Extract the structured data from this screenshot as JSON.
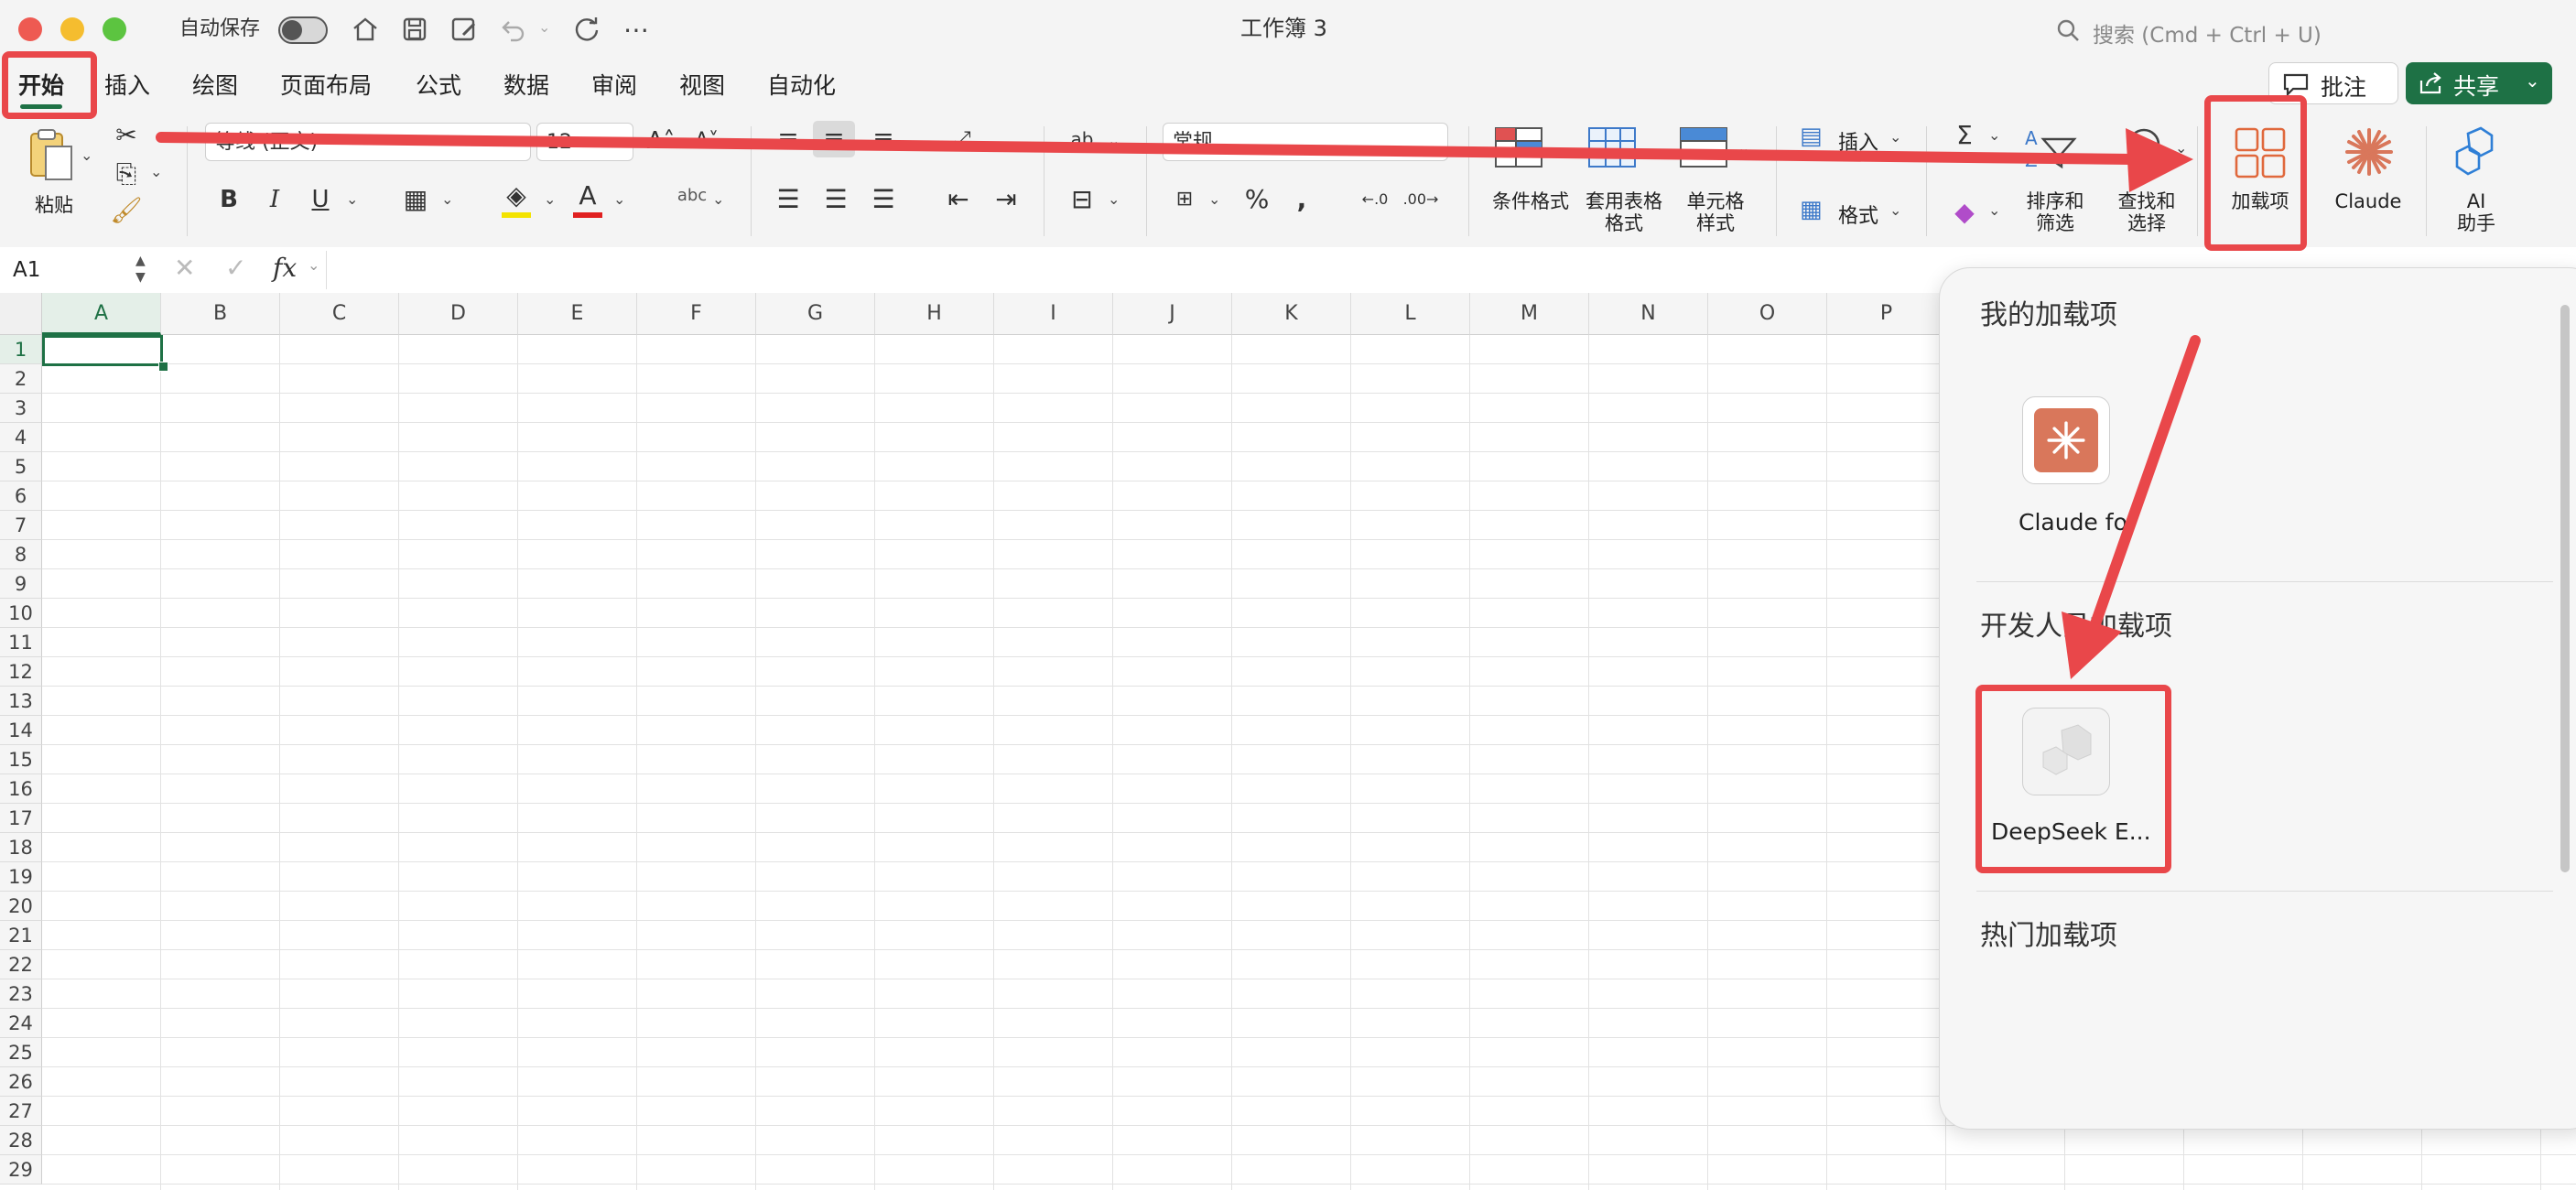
{
  "window": {
    "title": "工作簿 3",
    "autosave_label": "自动保存"
  },
  "search": {
    "placeholder": "搜索 (Cmd + Ctrl + U)"
  },
  "tabs": [
    "开始",
    "插入",
    "绘图",
    "页面布局",
    "公式",
    "数据",
    "审阅",
    "视图",
    "自动化"
  ],
  "active_tab": "开始",
  "header_buttons": {
    "comment_label": "批注",
    "share_label": "共享"
  },
  "ribbon": {
    "paste_label": "粘贴",
    "font_name": "等线 (正文)",
    "font_size": "12",
    "number_format": "常规",
    "bold": "B",
    "italic": "I",
    "underline": "U",
    "percent": "%",
    "conditional_format_label": "条件格式",
    "table_format_label": "套用表格格式",
    "table_format_line1": "套用表格",
    "table_format_line2": "格式",
    "cell_style_line1": "单元格",
    "cell_style_line2": "样式",
    "insert_label": "插入",
    "format_label": "格式",
    "sort_filter_line1": "排序和",
    "sort_filter_line2": "筛选",
    "find_select_line1": "查找和",
    "find_select_line2": "选择",
    "addins_label": "加载项",
    "claude_label": "Claude",
    "ai_line1": "AI",
    "ai_line2": "助手",
    "wrap_glyph": "ab",
    "orient_glyph": "abc"
  },
  "formula_bar": {
    "cell_ref": "A1",
    "fx": "fx",
    "value": ""
  },
  "grid": {
    "columns": [
      "A",
      "B",
      "C",
      "D",
      "E",
      "F",
      "G",
      "H",
      "I",
      "J",
      "K",
      "L",
      "M",
      "N",
      "O",
      "P"
    ],
    "rows": [
      "1",
      "2",
      "3",
      "4",
      "5",
      "6",
      "7",
      "8",
      "9",
      "10",
      "11",
      "12",
      "13",
      "14",
      "15",
      "16",
      "17",
      "18",
      "19",
      "20",
      "21",
      "22",
      "23",
      "24",
      "25",
      "26",
      "27",
      "28",
      "29"
    ],
    "selected_cell": "A1"
  },
  "addins_pane": {
    "my_addins_heading": "我的加载项",
    "claude_tile_label": "Claude for",
    "developer_heading": "开发人员加载项",
    "deepseek_tile_label": "DeepSeek E...",
    "popular_heading": "热门加载项"
  },
  "colors": {
    "accent_green": "#1e7145",
    "annotation_red": "#e9474a",
    "claude_orange": "#d9775b",
    "addins_orange": "#e0683c",
    "ai_blue": "#2f7fd6"
  }
}
